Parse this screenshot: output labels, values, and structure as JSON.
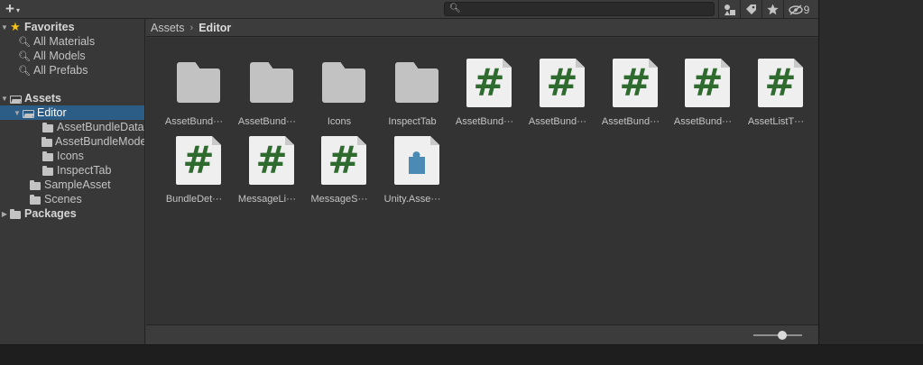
{
  "toolbar": {
    "create_plus": "+",
    "create_caret": "▾",
    "search_placeholder": "",
    "search_value": "",
    "icons": [
      "scene-filter-icon",
      "label-tag-icon",
      "favorite-star-icon",
      "hidden-eye-icon"
    ],
    "hidden_count": "9"
  },
  "tree": {
    "favorites": {
      "label": "Favorites",
      "items": [
        "All Materials",
        "All Models",
        "All Prefabs"
      ]
    },
    "assets": {
      "label": "Assets",
      "editor": {
        "label": "Editor",
        "children": [
          "AssetBundleData",
          "AssetBundleModel",
          "Icons",
          "InspectTab"
        ]
      },
      "children": [
        "SampleAsset",
        "Scenes"
      ]
    },
    "packages": {
      "label": "Packages"
    }
  },
  "breadcrumb": {
    "root": "Assets",
    "separator": "›",
    "current": "Editor"
  },
  "grid": {
    "items": [
      {
        "type": "folder",
        "name": "AssetBund···"
      },
      {
        "type": "folder",
        "name": "AssetBund···"
      },
      {
        "type": "folder",
        "name": "Icons"
      },
      {
        "type": "folder",
        "name": "InspectTab"
      },
      {
        "type": "script",
        "name": "AssetBund···"
      },
      {
        "type": "script",
        "name": "AssetBund···"
      },
      {
        "type": "script",
        "name": "AssetBund···"
      },
      {
        "type": "script",
        "name": "AssetBund···"
      },
      {
        "type": "script",
        "name": "AssetListT···"
      },
      {
        "type": "script",
        "name": "BundleDet···"
      },
      {
        "type": "script",
        "name": "MessageLi···"
      },
      {
        "type": "script",
        "name": "MessageS···"
      },
      {
        "type": "assembly",
        "name": "Unity.Asse···"
      }
    ],
    "script_glyph": "#"
  },
  "footer": {
    "zoom_level": 0.5
  },
  "colors": {
    "selection": "#2c5d87",
    "favorite_star": "#f4c316",
    "script_hash": "#2f6b2f",
    "assembly_puzzle": "#4a8ab3",
    "window_border": "#3a73b8"
  }
}
